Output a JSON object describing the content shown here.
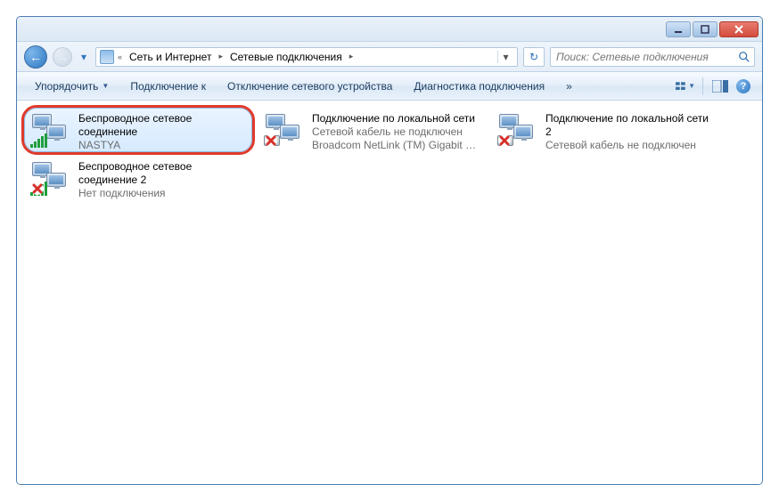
{
  "titlebar": {
    "minimize": "–",
    "maximize": "▢",
    "close": "✕"
  },
  "breadcrumb": {
    "back_glyph": "←",
    "fwd_glyph": "→",
    "chevrons": "«",
    "segments": [
      "Сеть и Интернет",
      "Сетевые подключения"
    ],
    "drop_glyph": "▾",
    "refresh_glyph": "↻"
  },
  "search": {
    "placeholder": "Поиск: Сетевые подключения",
    "value": ""
  },
  "cmdbar": {
    "organize": "Упорядочить",
    "connect_to": "Подключение к",
    "disable_device": "Отключение сетевого устройства",
    "diagnose": "Диагностика подключения",
    "more_glyph": "»",
    "help_glyph": "?"
  },
  "connections": [
    {
      "title": "Беспроводное сетевое соединение",
      "line2": "",
      "line3": "NASTYA",
      "icon": "wifi",
      "disconnected": false,
      "selected": true,
      "highlighted": true
    },
    {
      "title": "Подключение по локальной сети",
      "line2": "Сетевой кабель не подключен",
      "line3": "Broadcom NetLink (TM) Gigabit E...",
      "icon": "lan",
      "disconnected": true,
      "selected": false,
      "highlighted": false
    },
    {
      "title": "Подключение по локальной сети 2",
      "line2": "Сетевой кабель не подключен",
      "line3": "",
      "icon": "lan",
      "disconnected": true,
      "selected": false,
      "highlighted": false
    },
    {
      "title": "Беспроводное сетевое соединение 2",
      "line2": "Нет подключения",
      "line3": "",
      "icon": "wifi",
      "disconnected": true,
      "selected": false,
      "highlighted": false
    }
  ]
}
